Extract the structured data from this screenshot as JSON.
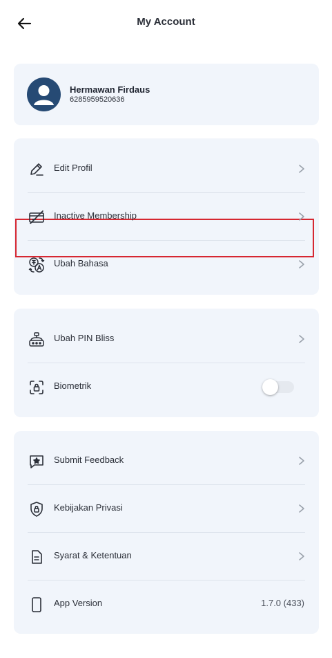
{
  "header": {
    "title": "My Account"
  },
  "profile": {
    "name": "Hermawan Firdaus",
    "phone": "6285959520636"
  },
  "section1": {
    "items": [
      {
        "label": "Edit Profil",
        "icon": "edit-pen-icon"
      },
      {
        "label": "Inactive Membership",
        "icon": "card-off-icon"
      },
      {
        "label": "Ubah Bahasa",
        "icon": "language-icon"
      }
    ]
  },
  "section2": {
    "items": [
      {
        "label": "Ubah PIN Bliss",
        "icon": "pin-keypad-icon"
      },
      {
        "label": "Biometrik",
        "icon": "biometric-lock-icon",
        "toggle_on": false
      }
    ]
  },
  "section3": {
    "items": [
      {
        "label": "Submit Feedback",
        "icon": "feedback-star-icon"
      },
      {
        "label": "Kebijakan Privasi",
        "icon": "shield-lock-icon"
      },
      {
        "label": "Syarat & Ketentuan",
        "icon": "document-icon"
      },
      {
        "label": "App Version",
        "icon": "phone-icon",
        "value": "1.7.0 (433)"
      }
    ]
  },
  "colors": {
    "highlight": "#d62731",
    "card_bg": "#f1f5fb",
    "avatar_bg": "#264a74"
  }
}
